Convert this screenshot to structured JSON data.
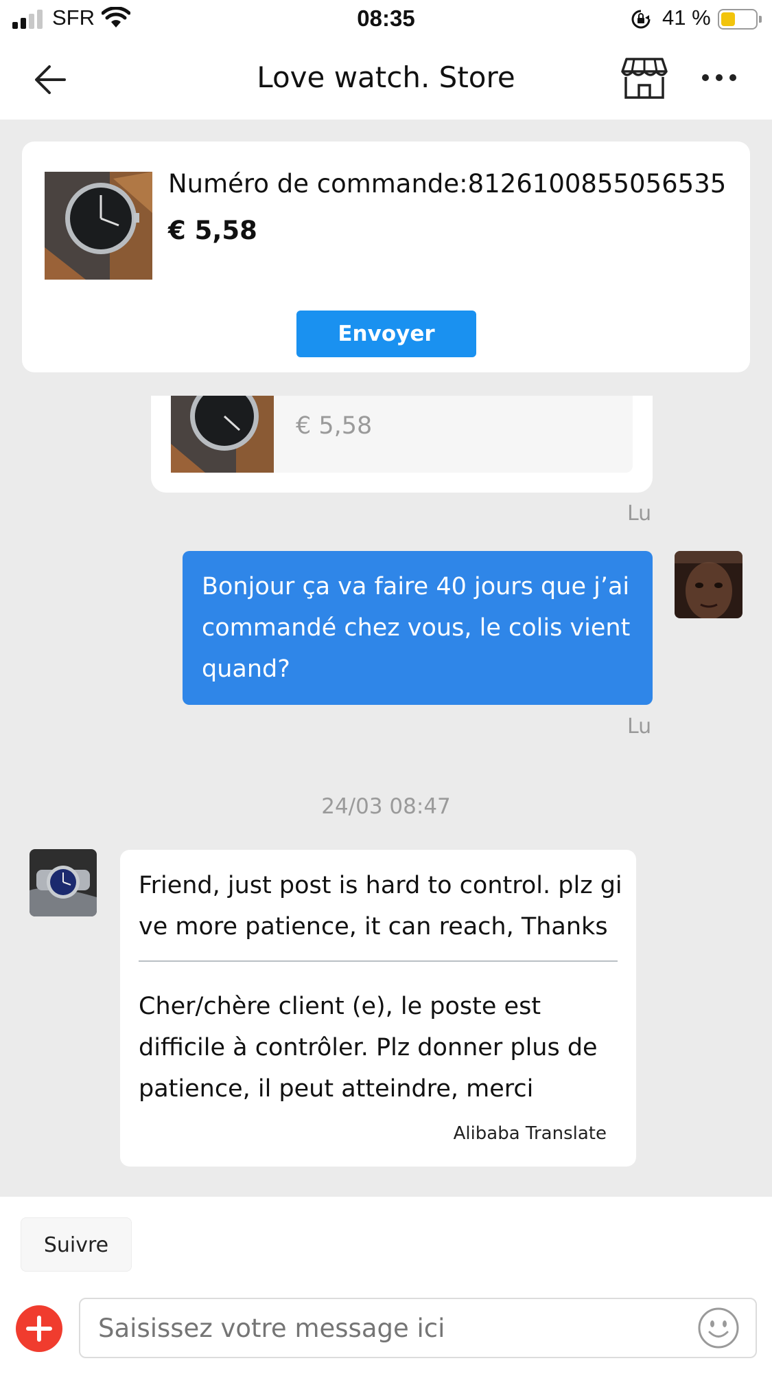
{
  "status_bar": {
    "carrier": "SFR",
    "time": "08:35",
    "battery_percent": "41 %",
    "battery_level": 0.41,
    "signal_bars": 2,
    "icons": [
      "signal-icon",
      "wifi-icon",
      "orientation-lock-icon",
      "battery-icon"
    ],
    "battery_color": "#f2c40c"
  },
  "nav": {
    "title": "Love watch. Store",
    "icons": [
      "back-arrow-icon",
      "store-icon",
      "more-icon"
    ]
  },
  "order_card": {
    "order_number": "Numéro de commande:8126100855056535",
    "price": "€ 5,58",
    "send_label": "Envoyer",
    "button_color": "#1a91f0"
  },
  "messages": {
    "product_price": "€ 5,58",
    "read_label_1": "Lu",
    "outgoing_text": "Bonjour ça va faire 40 jours que j’ai commandé chez vous, le colis vient quand?",
    "read_label_2": "Lu",
    "timestamp": "24/03 08:47",
    "incoming_original": "Friend, just post is hard to control. plz give more patience, it can reach, Thanks",
    "incoming_translated": "Cher/chère client (e), le poste est difficile à contrôler. Plz donner plus de patience, il peut atteindre, merci",
    "translation_credit": "Alibaba Translate",
    "outgoing_color": "#2f86e8"
  },
  "bottom": {
    "follow_label": "Suivre",
    "input_placeholder": "Saisissez votre message ici",
    "icons": [
      "plus-icon",
      "emoji-icon"
    ],
    "plus_color": "#f03c2e"
  }
}
